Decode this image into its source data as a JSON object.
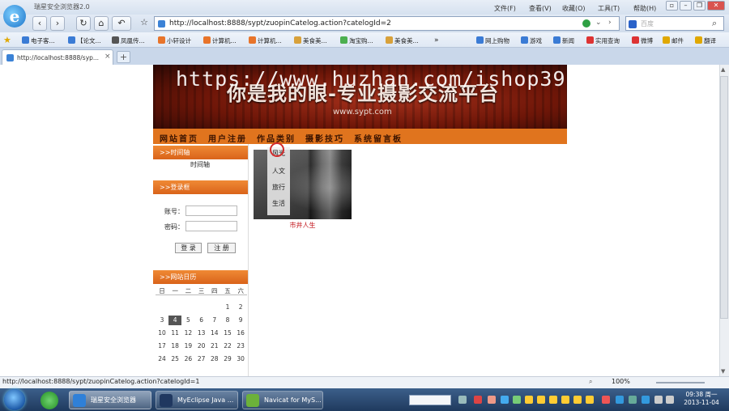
{
  "window": {
    "title": "瑞星安全浏览器2.0",
    "menus": [
      "文件(F)",
      "查看(V)",
      "收藏(O)",
      "工具(T)",
      "帮助(H)"
    ],
    "controls": [
      "▫",
      "–",
      "❐",
      "✕"
    ]
  },
  "toolbar": {
    "back": "‹",
    "forward": "›",
    "refresh": "↻",
    "home": "⌂",
    "undo": "↶",
    "favorite": "☆",
    "address": "http://localhost:8888/sypt/zuopinCatelog.action?catelogId=2",
    "search_placeholder": "百度"
  },
  "favorites": [
    "电子客...",
    "【论文...",
    "凤凰传...",
    "小轩设计",
    "计算机...",
    "计算机...",
    "美食美...",
    "淘宝购...",
    "美食美...",
    "网上购物",
    "游戏",
    "新闻",
    "实用查询",
    "微博",
    "邮件",
    "翻译"
  ],
  "favorites_more": "»",
  "tab": {
    "title": "http://localhost:8888/syp...",
    "close": "×",
    "new": "+"
  },
  "site": {
    "banner": {
      "title": "你是我的眼-专业摄影交流平台",
      "url": "www.sypt.com",
      "watermark": "https://www.huzhan.com/ishop39397"
    },
    "nav": [
      "网站首页",
      "用户注册",
      "作品类别",
      "摄影技巧",
      "系统留言板"
    ],
    "sidebar": {
      "timeline_header": ">>时间轴",
      "timeline_text": "时间轴",
      "login_header": ">>登录框",
      "account_label": "账号：",
      "password_label": "密码：",
      "login_button": "登 录",
      "register_button": "注 册",
      "calendar_header": ">>网站日历",
      "weekdays": [
        "日",
        "一",
        "二",
        "三",
        "四",
        "五",
        "六"
      ],
      "weeks": [
        [
          "",
          "",
          "",
          "",
          "",
          "1",
          "2"
        ],
        [
          "3",
          "4",
          "5",
          "6",
          "7",
          "8",
          "9"
        ],
        [
          "10",
          "11",
          "12",
          "13",
          "14",
          "15",
          "16"
        ],
        [
          "17",
          "18",
          "19",
          "20",
          "21",
          "22",
          "23"
        ],
        [
          "24",
          "25",
          "26",
          "27",
          "28",
          "29",
          "30"
        ]
      ],
      "today": "4"
    },
    "category_menu": [
      "风光",
      "人文",
      "旅行",
      "生活"
    ],
    "photo_caption": "市井人生"
  },
  "statusbar": {
    "url": "http://localhost:8888/sypt/zuopinCatelog.action?catelogId=1",
    "zoom": "100%"
  },
  "taskbar": {
    "buttons": [
      "瑞星安全浏览器",
      "MyEclipse Java ...",
      "Navicat for MyS..."
    ],
    "time": "09:38 周一",
    "date": "2013-11-04"
  }
}
